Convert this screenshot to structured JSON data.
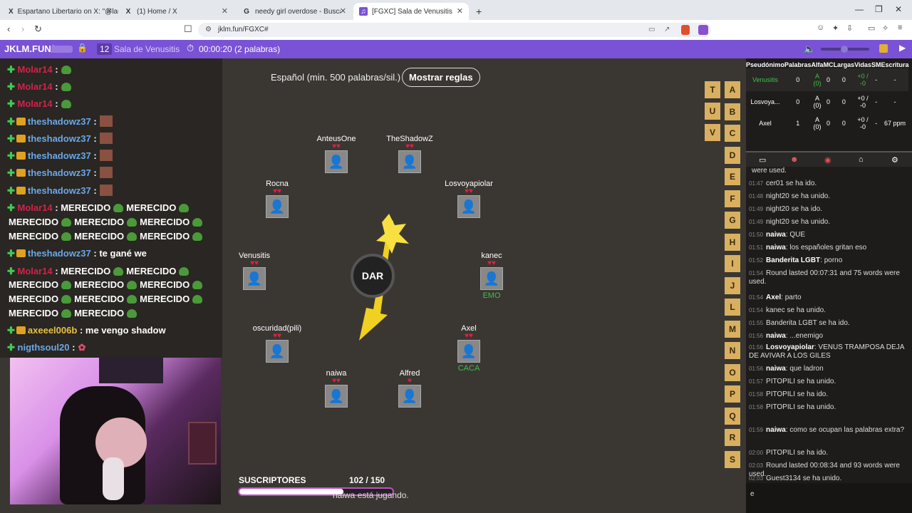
{
  "tabs": [
    {
      "icon": "X",
      "title": "Espartano Libertario on X: \"@ladere...",
      "close": "✕"
    },
    {
      "icon": "X",
      "title": "(1) Home / X",
      "close": "✕"
    },
    {
      "icon": "G",
      "title": "needy girl overdose - Buscar con Goo...",
      "close": "✕"
    },
    {
      "icon": "♫",
      "title": "[FGXC] Sala de Venusitis",
      "close": "✕"
    }
  ],
  "new_tab": "+",
  "address": "jklm.fun/FGXC#",
  "topbar": {
    "site": "JKLM.FUN/",
    "count": "12",
    "room": "Sala de Venusitis",
    "timer": "00:00:20 (2 palabras)"
  },
  "chat_left": [
    {
      "name": "Molar14",
      "style": "n1",
      "text": ":",
      "emote": "pepe"
    },
    {
      "name": "Molar14",
      "style": "n1",
      "text": ":",
      "emote": "pepe"
    },
    {
      "name": "Molar14",
      "style": "n1",
      "text": ":",
      "emote": "pepe"
    },
    {
      "name": "theshadowz37",
      "style": "n2",
      "text": ":",
      "emote": "face",
      "crown": true
    },
    {
      "name": "theshadowz37",
      "style": "n2",
      "text": ":",
      "emote": "face",
      "crown": true
    },
    {
      "name": "theshadowz37",
      "style": "n2",
      "text": ":",
      "emote": "face",
      "crown": true
    },
    {
      "name": "theshadowz37",
      "style": "n2",
      "text": ":",
      "emote": "face",
      "crown": true
    },
    {
      "name": "theshadowz37",
      "style": "n2",
      "text": ":",
      "emote": "face",
      "crown": true
    }
  ],
  "chat_merecido_name": "Molar14",
  "merecido": "MERECIDO",
  "chat_msg1": {
    "name": "theshadowz37",
    "text": ": te gané we"
  },
  "chat_msg2": {
    "name": "axeeel006b",
    "text": ": me vengo shadow"
  },
  "chat_msg3": {
    "name": "nigthsoul20",
    "text": ":"
  },
  "game": {
    "rules_text": "Español (min. 500 palabras/sil.)",
    "rules_button": "Mostrar reglas",
    "bomb_label": "DAR",
    "subs_label": "SUSCRIPTORES",
    "subs_count": "102  / 150",
    "status": "naiwa está jugando.",
    "players": [
      {
        "name": "AnteusOne",
        "hearts": "♥♥",
        "word": ""
      },
      {
        "name": "TheShadowZ",
        "hearts": "♥♥",
        "word": ""
      },
      {
        "name": "Rocna",
        "hearts": "♥♥",
        "word": ""
      },
      {
        "name": "Losvoyapiolar",
        "hearts": "♥♥",
        "word": ""
      },
      {
        "name": "Venusitis",
        "hearts": "♥♥",
        "word": ""
      },
      {
        "name": "kanec",
        "hearts": "♥♥",
        "word": "EMO"
      },
      {
        "name": "oscuridad(pili)",
        "hearts": "♥♥",
        "word": ""
      },
      {
        "name": "Axel",
        "hearts": "♥♥",
        "word": "CACA"
      },
      {
        "name": "naiwa",
        "hearts": "♥♥",
        "word": ""
      },
      {
        "name": "Alfred",
        "hearts": "♥",
        "word": ""
      }
    ],
    "letters_col1": [
      "T",
      "U",
      "V"
    ],
    "letters_col2": [
      "A",
      "B",
      "C",
      "D",
      "E",
      "F",
      "G",
      "H",
      "I",
      "J",
      "L",
      "M",
      "N",
      "O",
      "P",
      "Q",
      "R",
      "S"
    ]
  },
  "scoreboard": {
    "headers": [
      "Pseudónimo",
      "Palabras",
      "Alfa",
      "MC",
      "Largas",
      "Vidas",
      "SM",
      "Escritura"
    ],
    "rows": [
      [
        "Venusitis",
        "0",
        "A (0)",
        "0",
        "0",
        "+0 / -0",
        "-",
        "-"
      ],
      [
        "Losvoya...",
        "0",
        "A (0)",
        "0",
        "0",
        "+0 / -0",
        "-",
        "-"
      ],
      [
        "Axel",
        "1",
        "A (0)",
        "0",
        "0",
        "+0 / -0",
        "-",
        "67 ppm"
      ]
    ]
  },
  "log": [
    {
      "t": "",
      "text": "were used."
    },
    {
      "t": "01:47",
      "text": "cer01 se ha ido."
    },
    {
      "t": "01:48",
      "text": "night20 se ha unido."
    },
    {
      "t": "01:49",
      "text": "night20 se ha ido."
    },
    {
      "t": "01:49",
      "text": "night20 se ha unido."
    },
    {
      "t": "01:50",
      "who": "naiwa",
      "text": ": QUE"
    },
    {
      "t": "01:51",
      "who": "naiwa",
      "text": ": los españoles gritan eso"
    },
    {
      "t": "01:52",
      "who": "Banderita LGBT",
      "text": ": porno"
    },
    {
      "t": "01:54",
      "text": "Round lasted 00:07:31 and 75 words were used."
    },
    {
      "t": "01:54",
      "who": "Axel",
      "text": ": parto"
    },
    {
      "t": "01:54",
      "text": "kanec se ha unido."
    },
    {
      "t": "01:55",
      "text": "Banderita LGBT se ha ido."
    },
    {
      "t": "01:56",
      "who": "naiwa",
      "text": ": ...enemigo"
    },
    {
      "t": "01:56",
      "who": "Losvoyapiolar",
      "text": ": VENUS TRAMPOSA DEJA DE AVIVAR A LOS GILES"
    },
    {
      "t": "01:56",
      "who": "naiwa",
      "text": ": que ladron"
    },
    {
      "t": "01:57",
      "text": "PITOPILI se ha unido."
    },
    {
      "t": "01:58",
      "text": "PITOPILI se ha ido."
    },
    {
      "t": "01:58",
      "text": "PITOPILI se ha unido."
    },
    {
      "t": "01:59",
      "who": "naiwa",
      "text": ": como se ocupan las palabras extra?"
    },
    {
      "t": "02:00",
      "text": "PITOPILI se ha ido."
    },
    {
      "t": "02:03",
      "text": "Round lasted 00:08:34 and 93 words were used."
    },
    {
      "t": "02:03",
      "text": "Guest3134 se ha unido."
    }
  ],
  "chat_input_value": "e",
  "subs_fraction": 0.68
}
